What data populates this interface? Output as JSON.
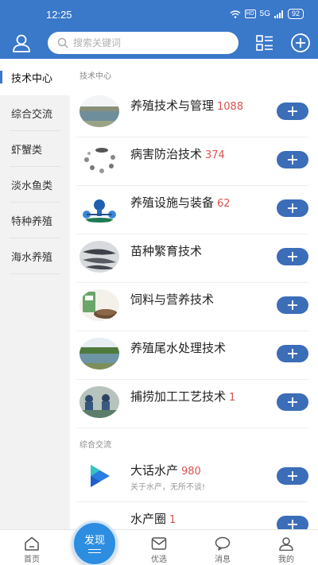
{
  "status_bar": {
    "time": "12:25",
    "hd": "HD",
    "signal": "5G",
    "battery": "92"
  },
  "header": {
    "search_placeholder": "搜索关键词"
  },
  "sidebar": {
    "items": [
      {
        "label": "技术中心"
      },
      {
        "label": "综合交流"
      },
      {
        "label": "虾蟹类"
      },
      {
        "label": "淡水鱼类"
      },
      {
        "label": "特种养殖"
      },
      {
        "label": "海水养殖"
      }
    ]
  },
  "main": {
    "section1_title": "技术中心",
    "tech_items": [
      {
        "name": "养殖技术与管理",
        "count": "1088",
        "thumb_icon": "pond-photo-icon"
      },
      {
        "name": "病害防治技术",
        "count": "374",
        "thumb_icon": "disease-diagram-icon"
      },
      {
        "name": "养殖设施与装备",
        "count": "62",
        "thumb_icon": "aerator-icon"
      },
      {
        "name": "苗种繁育技术",
        "count": "",
        "thumb_icon": "fish-fry-icon"
      },
      {
        "name": "饲料与营养技术",
        "count": "",
        "thumb_icon": "feed-bag-icon"
      },
      {
        "name": "养殖尾水处理技术",
        "count": "",
        "thumb_icon": "water-treatment-icon"
      },
      {
        "name": "捕捞加工工艺技术",
        "count": "1",
        "thumb_icon": "harvest-photo-icon"
      }
    ],
    "section2_title": "综合交流",
    "forum_items": [
      {
        "name": "大话水产",
        "count": "980",
        "sub": "关于水产，无所不谈!",
        "thumb_icon": "play-logo-icon"
      },
      {
        "name": "水产圈",
        "count": "1",
        "sub": "",
        "thumb_icon": "circle-icon"
      }
    ]
  },
  "bottom_nav": {
    "home": "首页",
    "discover": "发现",
    "featured": "优选",
    "messages": "消息",
    "mine": "我的"
  },
  "colors": {
    "primary": "#3a78c9",
    "button": "#3b6db8",
    "count": "#d9534f",
    "discover": "#2d8de0"
  }
}
